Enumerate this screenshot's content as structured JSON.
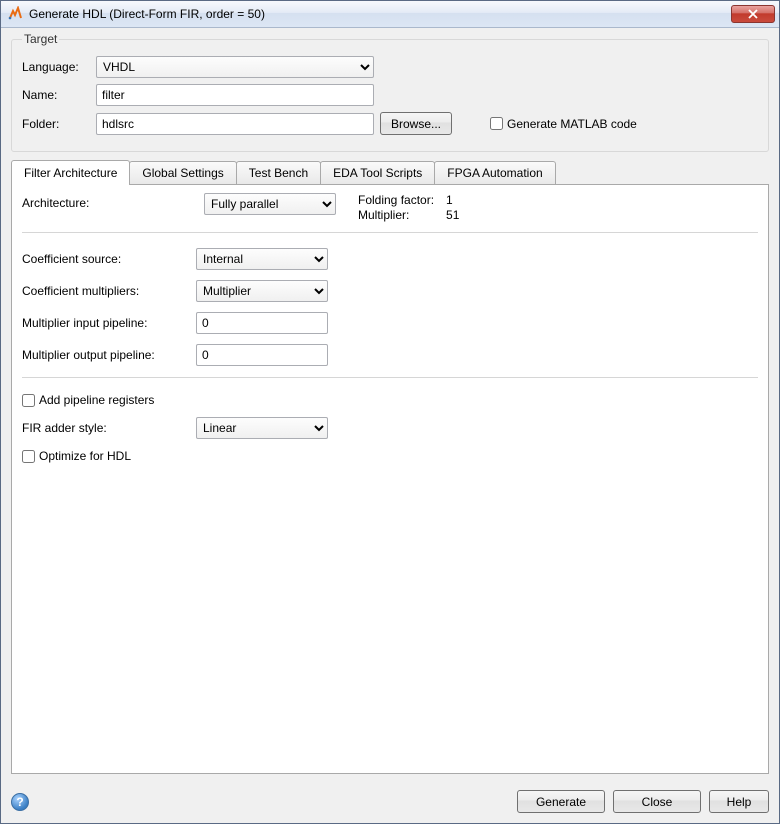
{
  "window": {
    "title": "Generate HDL (Direct-Form FIR, order = 50)"
  },
  "target": {
    "legend": "Target",
    "language_label": "Language:",
    "language_value": "VHDL",
    "name_label": "Name:",
    "name_value": "filter",
    "folder_label": "Folder:",
    "folder_value": "hdlsrc",
    "browse_label": "Browse...",
    "generate_matlab_label": "Generate MATLAB code",
    "generate_matlab_checked": false
  },
  "tabs": [
    {
      "label": "Filter Architecture",
      "active": true
    },
    {
      "label": "Global Settings",
      "active": false
    },
    {
      "label": "Test Bench",
      "active": false
    },
    {
      "label": "EDA Tool Scripts",
      "active": false
    },
    {
      "label": "FPGA Automation",
      "active": false
    }
  ],
  "arch": {
    "architecture_label": "Architecture:",
    "architecture_value": "Fully parallel",
    "folding_factor_label": "Folding factor:",
    "folding_factor_value": "1",
    "multiplier_label": "Multiplier:",
    "multiplier_value": "51",
    "coeff_source_label": "Coefficient source:",
    "coeff_source_value": "Internal",
    "coeff_mult_label": "Coefficient multipliers:",
    "coeff_mult_value": "Multiplier",
    "mult_in_pipe_label": "Multiplier input pipeline:",
    "mult_in_pipe_value": "0",
    "mult_out_pipe_label": "Multiplier output pipeline:",
    "mult_out_pipe_value": "0",
    "add_pipeline_label": "Add pipeline registers",
    "add_pipeline_checked": false,
    "fir_adder_label": "FIR adder style:",
    "fir_adder_value": "Linear",
    "optimize_label": "Optimize for HDL",
    "optimize_checked": false
  },
  "footer": {
    "generate": "Generate",
    "close": "Close",
    "help": "Help"
  }
}
